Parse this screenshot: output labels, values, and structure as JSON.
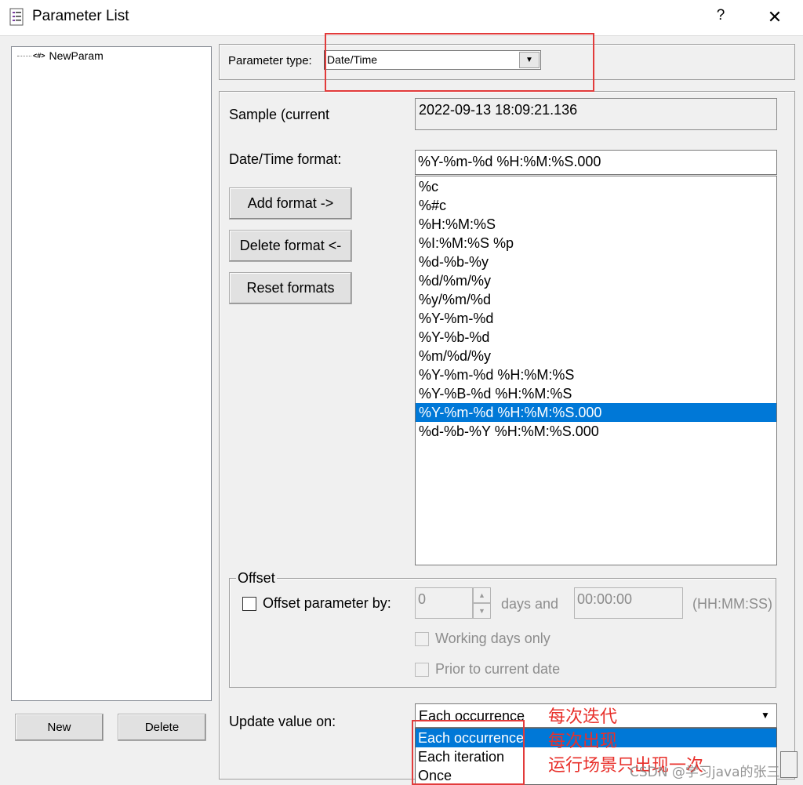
{
  "window": {
    "title": "Parameter List",
    "help": "?",
    "close": "✕"
  },
  "tree": {
    "item_icon": "<#>",
    "item_label": "NewParam"
  },
  "left_buttons": {
    "new": "New",
    "delete": "Delete"
  },
  "param_type": {
    "label": "Parameter type:",
    "value": "Date/Time"
  },
  "sample": {
    "label": "Sample (current",
    "value": "2022-09-13 18:09:21.136"
  },
  "datetime_format": {
    "label": "Date/Time format:",
    "value": "%Y-%m-%d %H:%M:%S.000"
  },
  "format_buttons": {
    "add": "Add format ->",
    "delete": "Delete format <-",
    "reset": "Reset formats"
  },
  "format_list": {
    "items": [
      "%c",
      "%#c",
      "%H:%M:%S",
      "%I:%M:%S %p",
      "%d-%b-%y",
      "%d/%m/%y",
      "%y/%m/%d",
      "%Y-%m-%d",
      "%Y-%b-%d",
      "%m/%d/%y",
      "%Y-%m-%d %H:%M:%S",
      "%Y-%B-%d %H:%M:%S",
      "%Y-%m-%d %H:%M:%S.000",
      "%d-%b-%Y %H:%M:%S.000"
    ],
    "selected_index": 12
  },
  "offset": {
    "group_title": "Offset",
    "checkbox_label": "Offset parameter by:",
    "days_value": "0",
    "days_and_label": "days and",
    "time_value": "00:00:00",
    "time_format_label": "(HH:MM:SS)",
    "working_days_label": "Working days only",
    "prior_label": "Prior to current date"
  },
  "update": {
    "label": "Update value on:",
    "value": "Each occurrence",
    "options": [
      "Each occurrence",
      "Each iteration",
      "Once"
    ],
    "selected_index": 0
  },
  "annotations": {
    "line1": "每次迭代",
    "line2": "每次出现",
    "line3": "运行场景只出现一次",
    "watermark": "CSDN @学习java的张三"
  },
  "colors": {
    "selection": "#0078d7",
    "annotation_red": "#e23b3b"
  }
}
